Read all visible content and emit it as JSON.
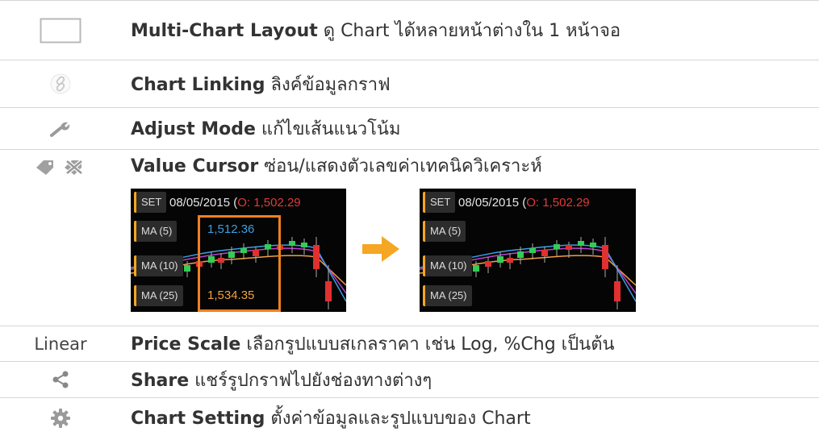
{
  "rows": [
    {
      "title": "Multi-Chart Layout",
      "desc": " ดู Chart ได้หลายหน้าต่างใน 1 หน้าจอ",
      "icon": "layout-rect-icon"
    },
    {
      "title": "Chart Linking",
      "desc": " ลิงค์ข้อมูลกราฟ",
      "icon": "link-icon"
    },
    {
      "title": "Adjust Mode",
      "desc": " แก้ไขเส้นแนวโน้ม",
      "icon": "wrench-icon"
    },
    {
      "title": "Value Cursor",
      "desc": " ซ่อน/แสดงตัวเลขค่าเทคนิควิเคราะห์",
      "icon": "tag-icons"
    },
    {
      "title": "Price Scale",
      "desc": " เลือกรูปแบบสเกลราคา เช่น Log, %Chg เป็นต้น",
      "icon_text": "Linear"
    },
    {
      "title": "Share",
      "desc": " แชร์รูปกราฟไปยังช่องทางต่างๆ",
      "icon": "share-icon"
    },
    {
      "title": "Chart Setting",
      "desc": "  ตั้งค่าข้อมูลและรูปแบบของ Chart",
      "icon": "gear-icon"
    }
  ],
  "screenshots": {
    "symbol": "SET",
    "date": "08/05/2015 (",
    "open_label": "O: 1,502.29",
    "open_label_b": "O: 1,502.29",
    "ma5": "MA (5)",
    "ma10": "MA (10)",
    "ma25": "MA (25)",
    "ma5_value": "1,512.36",
    "ma25_value": "1,534.35"
  },
  "colors": {
    "accent": "#f08020",
    "up": "#33cc55",
    "down": "#e03030"
  }
}
